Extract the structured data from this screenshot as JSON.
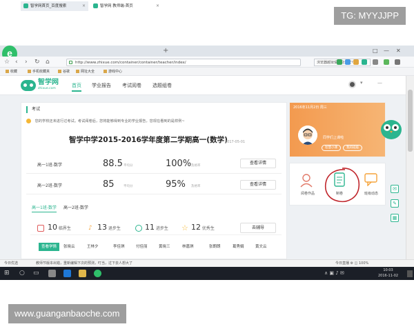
{
  "watermarks": {
    "top": "TG: MYYJJPP",
    "bottom": "www.guanganbaoche.com"
  },
  "browser": {
    "tabs": [
      {
        "label": "智学网首页_百度搜索"
      },
      {
        "label": "智学网 教师端-首页"
      }
    ],
    "new_tab": "+",
    "url": "http://www.zhixue.com/container/container/teacher/index/",
    "search_box": "浏览器越狱受欢迎大宝?",
    "window_controls": [
      "□",
      "—",
      "✕"
    ],
    "bookmarks": [
      "收藏",
      "手机收藏夹",
      "谷歌",
      "网址大全",
      "游戏中心"
    ]
  },
  "site": {
    "logo_name": "智学网",
    "logo_sub": "zhixue.com",
    "nav": [
      "首页",
      "学业报告",
      "考试阅卷",
      "选题组卷"
    ],
    "user_caret": "▾",
    "user_dash": "—"
  },
  "main": {
    "section_title": "考试",
    "notice": "您的学校还未进行过考试。考试阅卷后，您将能够得到专业的学业报告，您现在看到的是样例~",
    "report_title": "智学中学2015-2016学年度第二学期高一(数学)",
    "report_date": "2017-05-01",
    "rows": [
      {
        "label": "高一1班-数学",
        "avg": "88.5",
        "avg_label": "平均分",
        "rate": "100%",
        "rate_label": "及格率",
        "button": "查看详情"
      },
      {
        "label": "高一2班-数学",
        "avg": "85",
        "avg_label": "平均分",
        "rate": "95%",
        "rate_label": "及格率",
        "button": "查看详情"
      }
    ],
    "sub_tabs": [
      "高一1班-数学",
      "高一2班-数学"
    ],
    "stats": [
      {
        "value": "10",
        "label": "临界生"
      },
      {
        "value": "13",
        "label": "退步生"
      },
      {
        "value": "11",
        "label": "进步生"
      },
      {
        "value": "12",
        "label": "优秀生"
      }
    ],
    "tutor_button": "去辅导",
    "names": [
      "查看学情",
      "张晓云",
      "王林夕",
      "李佳琪",
      "付佳丽",
      "黄晓三",
      "林嘉琪",
      "张朗朗",
      "葛秀娟",
      "黄文云"
    ]
  },
  "right": {
    "card_top": "2016年11月2日  周三",
    "card_mid": "同学们上课啦",
    "card_buttons": [
      "智慧小课",
      "我的班级"
    ],
    "quick_links": [
      "阅卷作品",
      "制卷",
      "班级动态"
    ]
  },
  "side_tools": [
    "✉",
    "✎",
    "▦"
  ],
  "status_bar": {
    "left": "今日优选",
    "text": "教师节版本出错，重新编辑下次的预测，叮当，过下去人想大了",
    "right": "今日直播  ⚙  ◫  100%"
  },
  "taskbar": {
    "time": "10:03",
    "date": "2016-11-02"
  },
  "colors": {
    "brand": "#2bb58f",
    "accent_orange": "#f39a4f"
  }
}
